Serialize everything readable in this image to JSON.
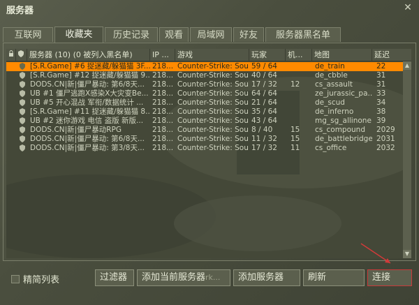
{
  "window": {
    "title": "服务器",
    "close": "✕"
  },
  "tabs": [
    "互联网",
    "收藏夹",
    "历史记录",
    "观看",
    "局域网",
    "好友",
    "服务器黑名单"
  ],
  "active_tab": 1,
  "columns": {
    "name": "服务器 (10) (0 被列入黑名单)",
    "ip": "IP ...",
    "game": "游戏",
    "players": "玩家",
    "bots": "机...",
    "map": "地图",
    "latency": "延迟"
  },
  "servers": [
    {
      "name": "[S.R.Game] #6 捉迷藏/躲猫猫 3F...",
      "ip": "218...",
      "game": "Counter-Strike: Sou...",
      "players": "59 / 64",
      "bots": "",
      "map": "de_train",
      "latency": "22",
      "selected": true
    },
    {
      "name": "[S.R.Game] #12 捉迷藏/躲猫猫 9...",
      "ip": "218...",
      "game": "Counter-Strike: Sou...",
      "players": "40 / 64",
      "bots": "",
      "map": "de_cbble",
      "latency": "31",
      "selected": false
    },
    {
      "name": "DODS.CN|新|僵尸暴动: 第6/8天...",
      "ip": "218...",
      "game": "Counter-Strike: Sou...",
      "players": "17 / 32",
      "bots": "12",
      "map": "cs_assault",
      "latency": "31",
      "selected": false
    },
    {
      "name": "UB #1 僵尸逃跑X感染X大灾变Be...",
      "ip": "218...",
      "game": "Counter-Strike: Sou...",
      "players": "64 / 64",
      "bots": "",
      "map": "ze_jurassic_pa...",
      "latency": "33",
      "selected": false
    },
    {
      "name": "UB #5 开心混战 军衔/数据统计 ...",
      "ip": "218...",
      "game": "Counter-Strike: Sou...",
      "players": "21 / 64",
      "bots": "",
      "map": "de_scud",
      "latency": "34",
      "selected": false
    },
    {
      "name": "[S.R.Game] #11 捉迷藏/躲猫猫 8...",
      "ip": "218...",
      "game": "Counter-Strike: Sou...",
      "players": "35 / 64",
      "bots": "",
      "map": "de_inferno",
      "latency": "38",
      "selected": false
    },
    {
      "name": "UB #2 迷你游戏 电信 盗版 新版...",
      "ip": "218...",
      "game": "Counter-Strike: Sou...",
      "players": "43 / 64",
      "bots": "",
      "map": "mg_sg_allinone...",
      "latency": "39",
      "selected": false
    },
    {
      "name": "DODS.CN|新|僵尸暴动RPG",
      "ip": "218...",
      "game": "Counter-Strike: Sou...",
      "players": "8 / 40",
      "bots": "15",
      "map": "cs_compound",
      "latency": "2029",
      "selected": false
    },
    {
      "name": "DODS.CN|新|僵尸暴动: 第6/8天...",
      "ip": "218...",
      "game": "Counter-Strike: Sou...",
      "players": "11 / 32",
      "bots": "15",
      "map": "de_battlebridge",
      "latency": "2031",
      "selected": false
    },
    {
      "name": "DODS.CN|新|僵尸暴动: 第3/8天...",
      "ip": "218...",
      "game": "Counter-Strike: Sou...",
      "players": "17 / 32",
      "bots": "11",
      "map": "cs_office",
      "latency": "2032",
      "selected": false
    }
  ],
  "bottom": {
    "simple_list_label": "精简列表",
    "filter_label": "过滤器",
    "add_current_label": "添加当前服务器",
    "ghost_text": "rk...",
    "add_server_label": "添加服务器",
    "refresh_label": "刷新",
    "connect_label": "连接"
  },
  "colors": {
    "selected_row": "#ff8a00",
    "connect_highlight": "#c83a3a"
  }
}
